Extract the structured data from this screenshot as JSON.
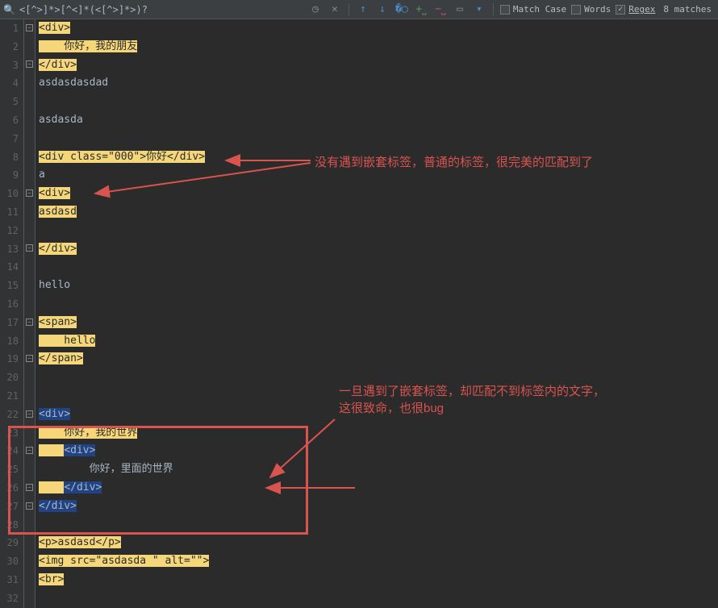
{
  "search": {
    "pattern": "<[^>]*>[^<]*(<[^>]*>)?",
    "matchCase": "Match Case",
    "words": "Words",
    "regex": "Regex",
    "count": "8 matches"
  },
  "gutter": [
    "1",
    "2",
    "3",
    "4",
    "5",
    "6",
    "7",
    "8",
    "9",
    "10",
    "11",
    "12",
    "13",
    "14",
    "15",
    "16",
    "17",
    "18",
    "19",
    "20",
    "21",
    "22",
    "23",
    "24",
    "25",
    "26",
    "27",
    "28",
    "29",
    "30",
    "31",
    "32"
  ],
  "code": {
    "l1": "<div>",
    "l2": "    你好，我的朋友",
    "l3": "</div>",
    "l4": "asdasdasdad",
    "l5": "",
    "l6": "asdasda",
    "l7": "",
    "l8a": "<div class=\"000\">你好</div>",
    "l9": "a",
    "l10": "<div>",
    "l11": "asdasd",
    "l12": "",
    "l13": "</div>",
    "l14": "",
    "l15": "hello",
    "l16": "",
    "l17": "<span>",
    "l18": "    hello",
    "l19": "</span>",
    "l20": "",
    "l21": "",
    "l22": "<div>",
    "l23": "    你好，我的世界",
    "l24a": "    ",
    "l24b": "<div>",
    "l25": "        你好，里面的世界",
    "l26a": "    ",
    "l26b": "</div>",
    "l27": "</div>",
    "l28": "",
    "l29": "<p>asdasd</p>",
    "l30": "<img src=\"asdasda \" alt=\"\">",
    "l31": "<br>",
    "l32": ""
  },
  "annotations": {
    "a1": "没有遇到嵌套标签，普通的标签，很完美的匹配到了",
    "a2_line1": "一旦遇到了嵌套标签，却匹配不到标签内的文字，",
    "a2_line2": "这很致命，也很bug"
  }
}
